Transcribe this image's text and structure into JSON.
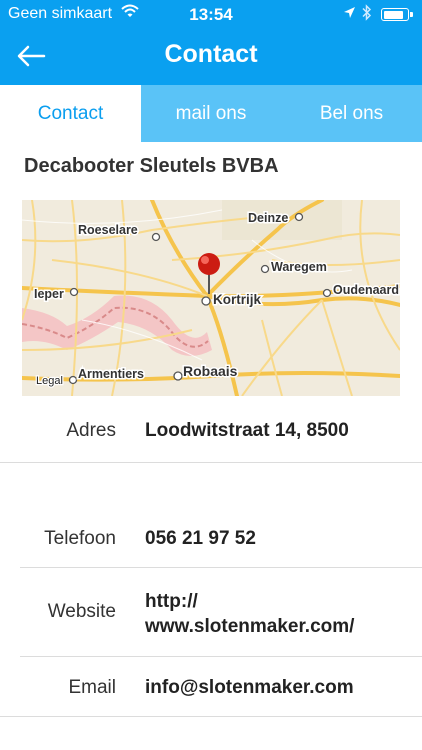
{
  "status_bar": {
    "carrier": "Geen simkaart",
    "time": "13:54",
    "battery_level": 0.9
  },
  "nav": {
    "title": "Contact",
    "back_icon": "arrow-left-icon"
  },
  "tabs": [
    {
      "label": "Contact",
      "active": true
    },
    {
      "label": "mail ons",
      "active": false
    },
    {
      "label": "Bel ons",
      "active": false
    }
  ],
  "company_name": "Decabooter Sleutels BVBA",
  "map": {
    "places": [
      "Roeselare",
      "Deinze",
      "Waregem",
      "Ieper",
      "Kortrijk",
      "Oudenaard",
      "Armentiers",
      "Robaais"
    ],
    "legal": "Legal"
  },
  "details": {
    "address_label": "Adres",
    "address_value": "Loodwitstraat 14, 8500",
    "phone_label": "Telefoon",
    "phone_value": "056 21 97 52",
    "website_label": "Website",
    "website_line1": "http://",
    "website_line2": "www.slotenmaker.com/",
    "email_label": "Email",
    "email_value": "info@slotenmaker.com"
  },
  "colors": {
    "header": "#0aa0f0",
    "tabs": "#5ac3f7",
    "active_tab_text": "#0a9eef"
  }
}
